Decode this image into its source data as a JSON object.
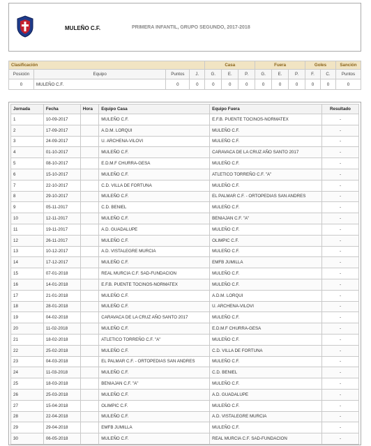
{
  "header": {
    "club": "MULEÑO C.F.",
    "competition": "PRIMERA INFANTIL, GRUPO SEGUNDO, 2017-2018"
  },
  "classification": {
    "title": "Clasificación",
    "groups": {
      "casa": "Casa",
      "fuera": "Fuera",
      "goles": "Goles",
      "sancion": "Sanción"
    },
    "columns": [
      "Posición",
      "Equipo",
      "Puntos",
      "J.",
      "G.",
      "E.",
      "P.",
      "G.",
      "E.",
      "P.",
      "F.",
      "C.",
      "Puntos"
    ],
    "row": [
      "0",
      "MULEÑO C.F.",
      "0",
      "0",
      "0",
      "0",
      "0",
      "0",
      "0",
      "0",
      "0",
      "0",
      "0"
    ]
  },
  "results": {
    "columns": [
      "Jornada",
      "Fecha",
      "Hora",
      "Equipo Casa",
      "Equipo Fuera",
      "Resultado"
    ],
    "rows": [
      [
        "1",
        "10-09-2017",
        "",
        "MULEÑO C.F.",
        "E.F.B. PUENTE TOCINOS-NORMATEX",
        "-"
      ],
      [
        "2",
        "17-09-2017",
        "",
        "A.D.M. LORQUI",
        "MULEÑO C.F.",
        "-"
      ],
      [
        "3",
        "24-09-2017",
        "",
        "U. ARCHENA-VILOVI",
        "MULEÑO C.F.",
        "-"
      ],
      [
        "4",
        "01-10-2017",
        "",
        "MULEÑO C.F.",
        "CARAVACA DE LA CRUZ AÑO SANTO 2017",
        "-"
      ],
      [
        "5",
        "08-10-2017",
        "",
        "E.D.M.F CHURRA-GESA",
        "MULEÑO C.F.",
        "-"
      ],
      [
        "6",
        "15-10-2017",
        "",
        "MULEÑO C.F.",
        "ATLETICO TORREÑO C.F. \"A\"",
        "-"
      ],
      [
        "7",
        "22-10-2017",
        "",
        "C.D. VILLA DE FORTUNA",
        "MULEÑO C.F.",
        "-"
      ],
      [
        "8",
        "29-10-2017",
        "",
        "MULEÑO C.F.",
        "EL PALMAR C.F. - ORTOPEDIAS SAN ANDRES",
        "-"
      ],
      [
        "9",
        "05-11-2017",
        "",
        "C.D. BENIEL",
        "MULEÑO C.F.",
        "-"
      ],
      [
        "10",
        "12-11-2017",
        "",
        "MULEÑO C.F.",
        "BENIAJAN C.F. \"A\"",
        "-"
      ],
      [
        "11",
        "19-11-2017",
        "",
        "A.D. GUADALUPE",
        "MULEÑO C.F.",
        "-"
      ],
      [
        "12",
        "26-11-2017",
        "",
        "MULEÑO C.F.",
        "OLIMPIC C.F.",
        "-"
      ],
      [
        "13",
        "10-12-2017",
        "",
        "A.D. VISTALEGRE MURCIA",
        "MULEÑO C.F.",
        "-"
      ],
      [
        "14",
        "17-12-2017",
        "",
        "MULEÑO C.F.",
        "EMFB JUMILLA",
        "-"
      ],
      [
        "15",
        "07-01-2018",
        "",
        "REAL MURCIA C.F. SAD-FUNDACION",
        "MULEÑO C.F.",
        "-"
      ],
      [
        "16",
        "14-01-2018",
        "",
        "E.F.B. PUENTE TOCINOS-NORMATEX",
        "MULEÑO C.F.",
        "-"
      ],
      [
        "17",
        "21-01-2018",
        "",
        "MULEÑO C.F.",
        "A.D.M. LORQUI",
        "-"
      ],
      [
        "18",
        "28-01-2018",
        "",
        "MULEÑO C.F.",
        "U. ARCHENA-VILOVI",
        "-"
      ],
      [
        "19",
        "04-02-2018",
        "",
        "CARAVACA DE LA CRUZ AÑO SANTO 2017",
        "MULEÑO C.F.",
        "-"
      ],
      [
        "20",
        "11-02-2018",
        "",
        "MULEÑO C.F.",
        "E.D.M.F CHURRA-GESA",
        "-"
      ],
      [
        "21",
        "18-02-2018",
        "",
        "ATLETICO TORREÑO C.F. \"A\"",
        "MULEÑO C.F.",
        "-"
      ],
      [
        "22",
        "25-02-2018",
        "",
        "MULEÑO C.F.",
        "C.D. VILLA DE FORTUNA",
        "-"
      ],
      [
        "23",
        "04-03-2018",
        "",
        "EL PALMAR C.F. - ORTOPEDIAS SAN ANDRES",
        "MULEÑO C.F.",
        "-"
      ],
      [
        "24",
        "11-03-2018",
        "",
        "MULEÑO C.F.",
        "C.D. BENIEL",
        "-"
      ],
      [
        "25",
        "18-03-2018",
        "",
        "BENIAJAN C.F. \"A\"",
        "MULEÑO C.F.",
        "-"
      ],
      [
        "26",
        "25-03-2018",
        "",
        "MULEÑO C.F.",
        "A.D. GUADALUPE",
        "-"
      ],
      [
        "27",
        "15-04-2018",
        "",
        "OLIMPIC C.F.",
        "MULEÑO C.F.",
        "-"
      ],
      [
        "28",
        "22-04-2018",
        "",
        "MULEÑO C.F.",
        "A.D. VISTALEGRE MURCIA",
        "-"
      ],
      [
        "29",
        "29-04-2018",
        "",
        "EMFB JUMILLA",
        "MULEÑO C.F.",
        "-"
      ],
      [
        "30",
        "06-05-2018",
        "",
        "MULEÑO C.F.",
        "REAL MURCIA C.F. SAD-FUNDACION",
        "-"
      ]
    ]
  }
}
